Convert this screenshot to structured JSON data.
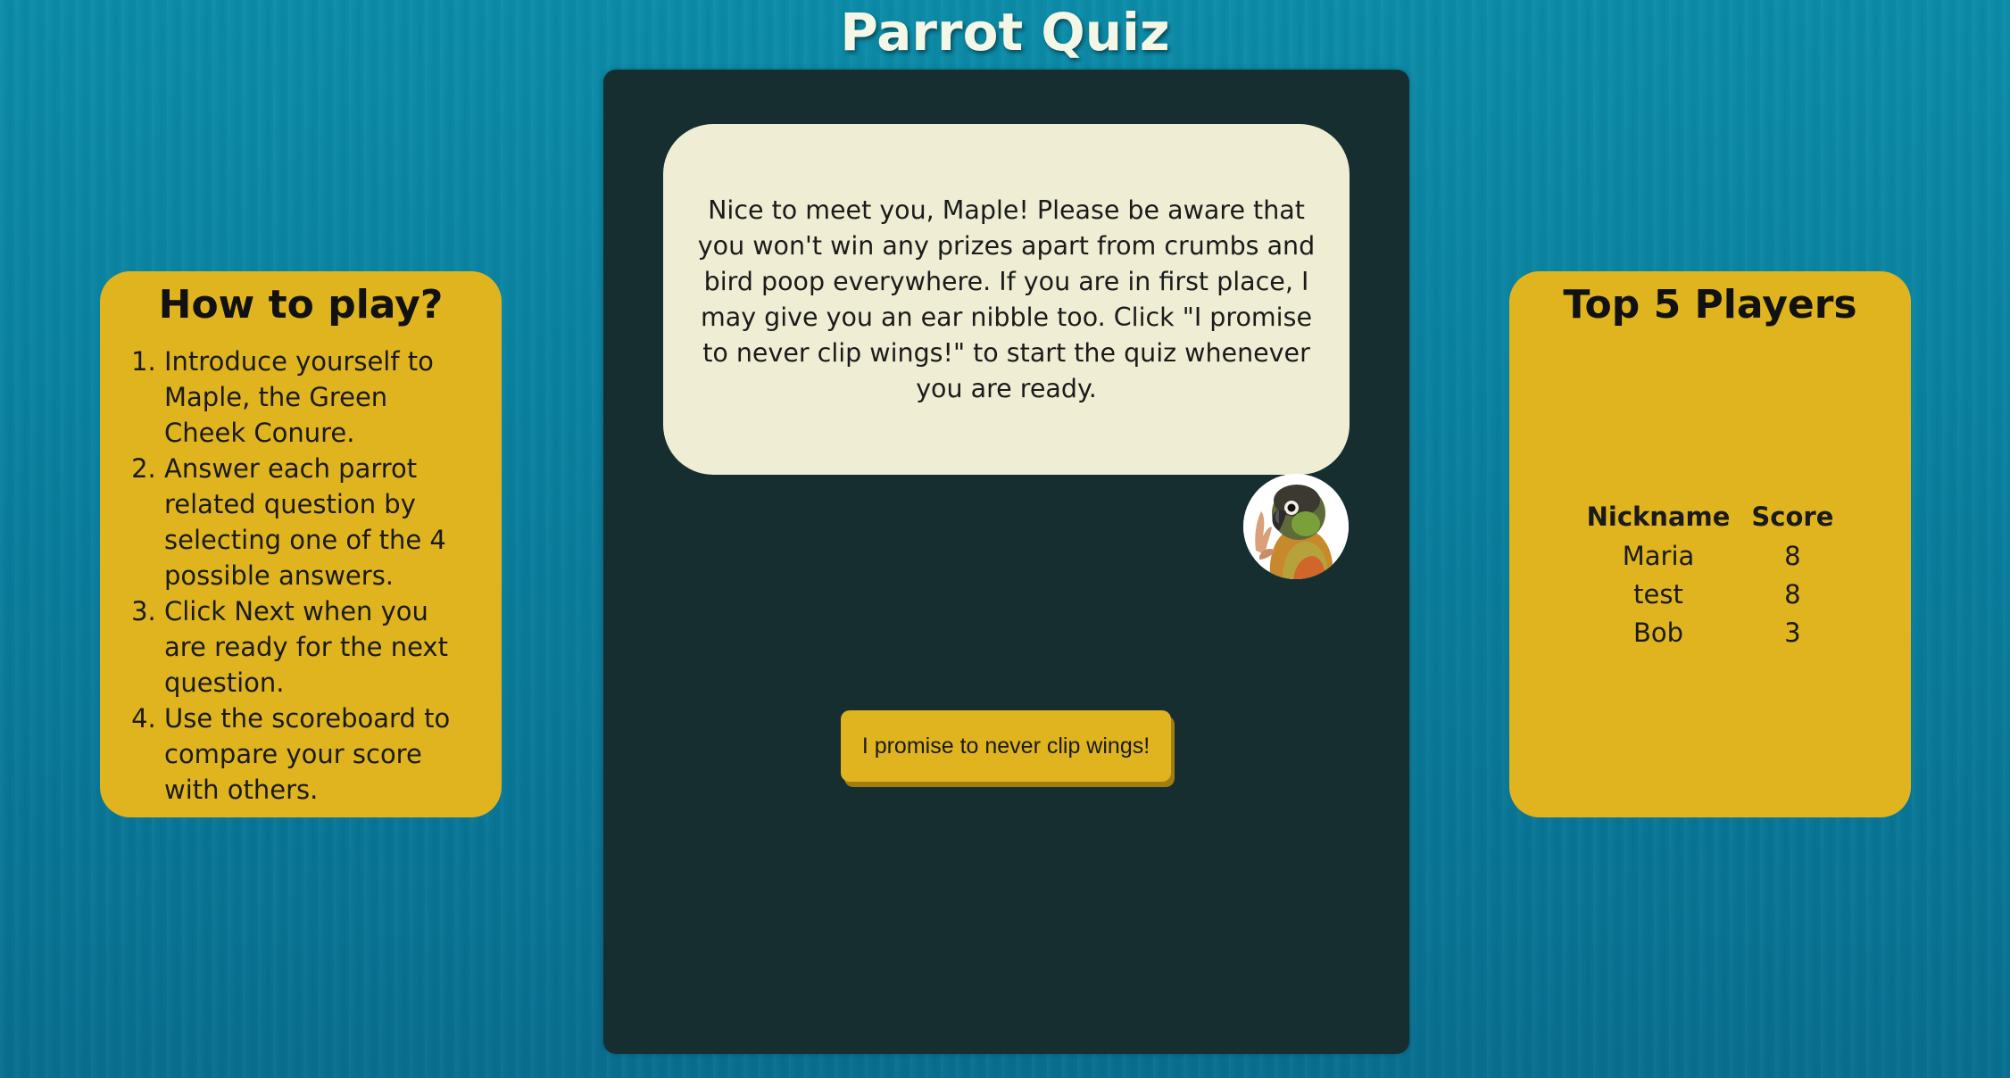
{
  "page": {
    "title": "Parrot Quiz"
  },
  "how_to_play": {
    "heading": "How to play?",
    "steps": [
      "Introduce yourself to Maple, the Green Cheek Conure.",
      "Answer each parrot related question by selecting one of the 4 possible answers.",
      "Click Next when you are ready for the next question.",
      "Use the scoreboard to compare your score with others."
    ]
  },
  "game": {
    "message": "Nice to meet you, Maple! Please be aware that you won't win any prizes apart from crumbs and bird poop everywhere. If you are in first place, I may give you an ear nibble too. Click \"I promise to never clip wings!\" to start the quiz whenever you are ready.",
    "start_button_label": "I promise to never clip wings!",
    "avatar_icon": "green-cheek-conure-avatar"
  },
  "scoreboard": {
    "heading": "Top 5 Players",
    "columns": [
      "Nickname",
      "Score"
    ],
    "rows": [
      {
        "nickname": "Maria",
        "score": "8"
      },
      {
        "nickname": "test",
        "score": "8"
      },
      {
        "nickname": "Bob",
        "score": "3"
      }
    ]
  },
  "colors": {
    "background": "#0a7f9e",
    "panel": "#172e31",
    "card": "#dfb41f",
    "bubble": "#efedd4",
    "title_text": "#f4f7e6"
  }
}
